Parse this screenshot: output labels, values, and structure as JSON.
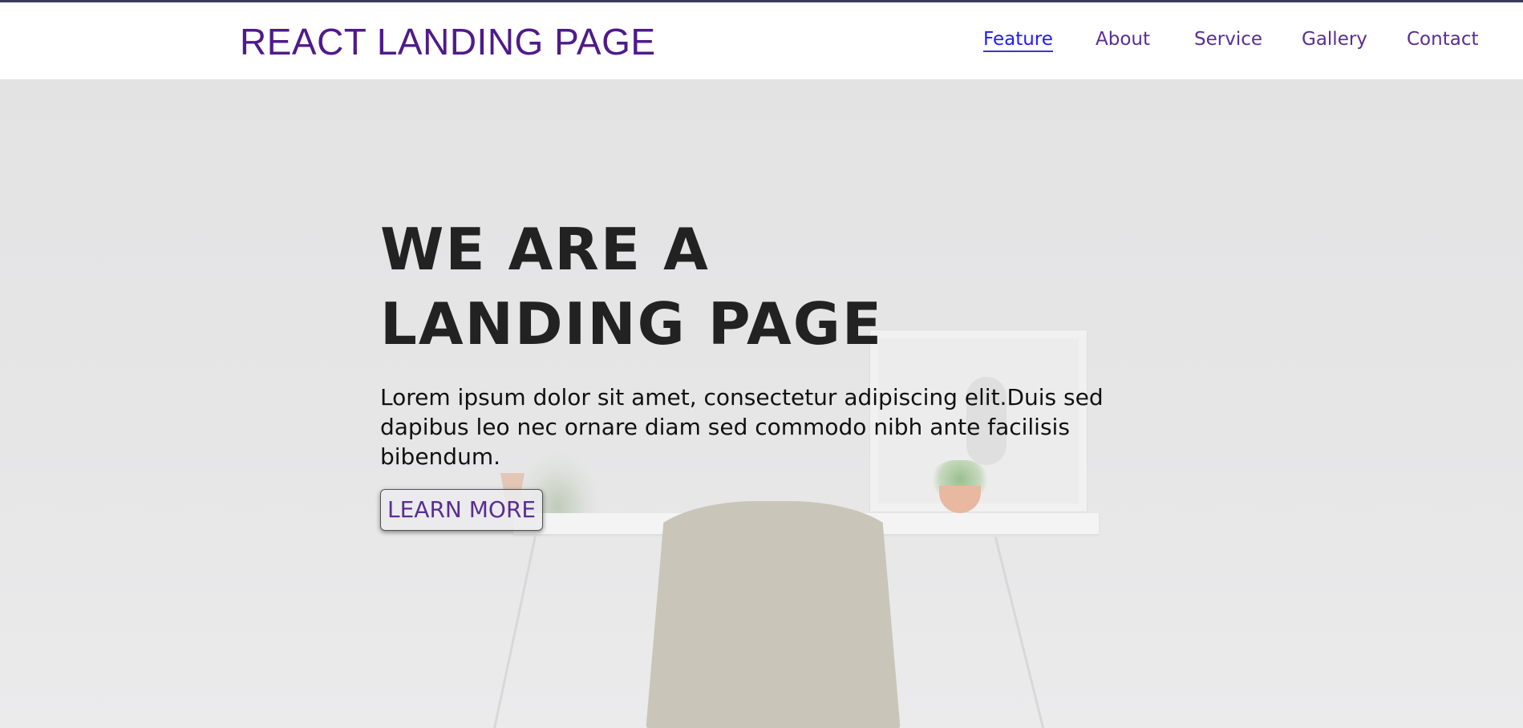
{
  "header": {
    "brand": "REACT LANDING PAGE",
    "nav": [
      {
        "label": "Feature",
        "active": true
      },
      {
        "label": "About"
      },
      {
        "label": "Service"
      },
      {
        "label": "Gallery"
      },
      {
        "label": "Contact"
      }
    ]
  },
  "hero": {
    "title": "WE ARE A\nLANDING PAGE",
    "text": "Lorem ipsum dolor sit amet, consectetur adipiscing elit.Duis sed dapibus leo nec ornare diam sed commodo nibh ante facilisis bibendum.",
    "button_label": "LEARN MORE"
  },
  "colors": {
    "brand": "#4f1a8a",
    "nav_link": "#5a2e91",
    "nav_active": "#1f1aff",
    "hero_bg": "#e6e6e7"
  }
}
